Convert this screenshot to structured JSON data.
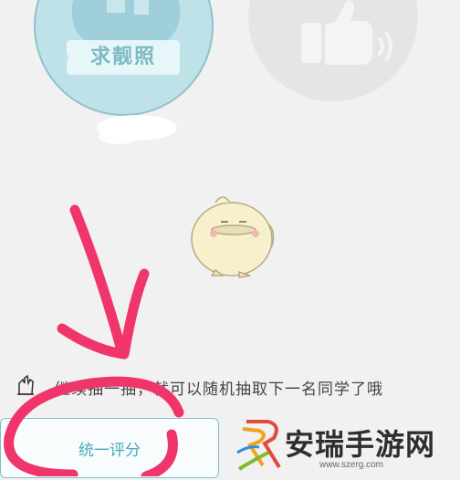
{
  "actions": {
    "left_circle_label": "求靓照"
  },
  "hint": {
    "text": "继续抽一抽，就可以随机抽取下一名同学了哦"
  },
  "footer": {
    "rate_all_label": "统一评分"
  },
  "watermark": {
    "name": "安瑞手游网",
    "url": "www.szerg.com"
  },
  "colors": {
    "accent_teal": "#48a9ba",
    "circle_teal": "#bfe1e8",
    "annotation_pink": "#f0356b",
    "background": "#f1f1f1"
  },
  "icons": {
    "left_circle": "thumbs-icon",
    "right_circle": "thumbs-up-icon",
    "mascot": "chick-mascot-icon",
    "hint": "shake-hand-icon"
  }
}
